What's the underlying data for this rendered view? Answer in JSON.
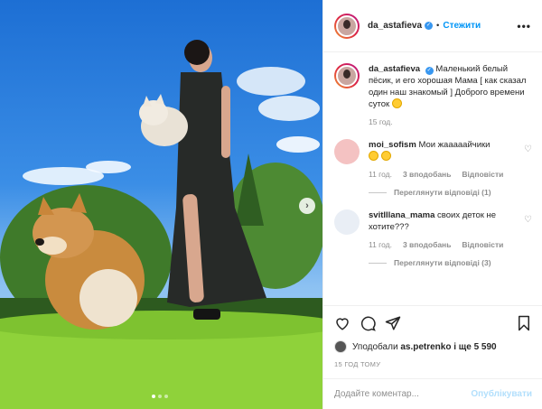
{
  "post": {
    "username": "da_astafieva",
    "follow_label": "Стежити",
    "dot": "•",
    "more_label": "•••",
    "caption_text": "Маленький белый пёсик, и его хорошая Мама [ как сказал один наш знакомый ] Доброго времени суток",
    "caption_age": "15 год."
  },
  "comments": [
    {
      "username": "moi_sofism",
      "text": "Мои жааааайчики",
      "age": "11 год.",
      "likes": "3 вподобань",
      "reply_label": "Відповісти",
      "view_replies": "Переглянути відповіді (1)"
    },
    {
      "username": "svitlllana_mama",
      "text": "своих деток не хотите???",
      "age": "11 год.",
      "likes": "3 вподобань",
      "reply_label": "Відповісти",
      "view_replies": "Переглянути відповіді (3)"
    }
  ],
  "likes_bar": {
    "prefix": "Уподобали",
    "user": "as.petrenko",
    "suffix": "і ще 5 590"
  },
  "timestamp": "15 ГОД ТОМУ",
  "add_comment": {
    "placeholder": "Додайте коментар...",
    "publish_label": "Опублікувати"
  },
  "icons": {
    "heart": "heart-icon",
    "comment": "comment-icon",
    "share": "share-icon",
    "bookmark": "bookmark-icon",
    "next": "chevron-right-icon"
  },
  "carousel": {
    "count": 3,
    "active_index": 0
  },
  "colors": {
    "accent": "#0095f6",
    "verified": "#3897f0",
    "muted": "#8e8e8e"
  }
}
